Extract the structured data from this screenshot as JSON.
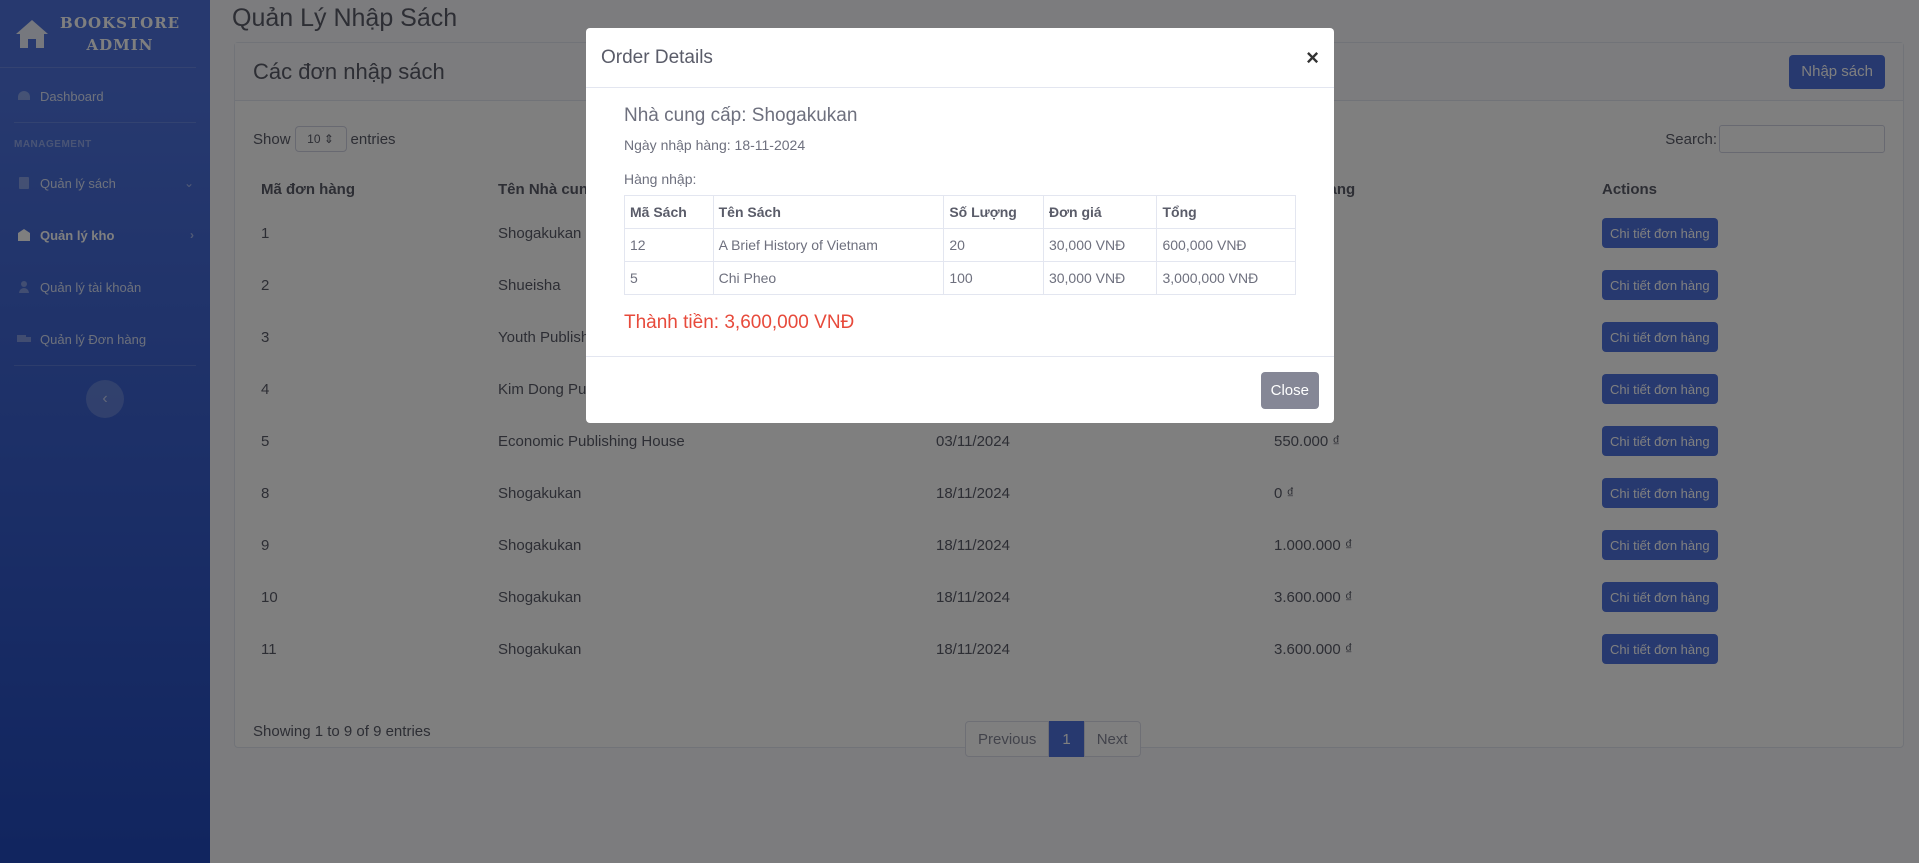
{
  "brand": {
    "line1": "BOOKSTORE",
    "line2": "ADMIN"
  },
  "sidebar": {
    "dashboard": "Dashboard",
    "heading": "MANAGEMENT",
    "items": [
      {
        "label": "Quản lý sách",
        "icon": "book-icon",
        "chevron": "chevron-down-icon"
      },
      {
        "label": "Quản lý kho",
        "icon": "warehouse-icon",
        "chevron": "chevron-right-icon"
      },
      {
        "label": "Quản lý tài khoản",
        "icon": "user-icon"
      },
      {
        "label": "Quản lý Đơn hàng",
        "icon": "truck-icon"
      }
    ]
  },
  "page": {
    "title": "Quản Lý Nhập Sách"
  },
  "card": {
    "title": "Các đơn nhập sách",
    "add_button": "Nhập sách",
    "show_label": "Show",
    "show_value": "10",
    "entries_label": "entries",
    "search_label": "Search:",
    "columns": [
      "Mã đơn hàng",
      "Tên Nhà cung",
      "",
      "n hàng",
      "Actions"
    ],
    "rows": [
      {
        "id": "1",
        "supplier": "Shogakukan",
        "date": "",
        "total": ""
      },
      {
        "id": "2",
        "supplier": "Shueisha",
        "date": "",
        "total": ""
      },
      {
        "id": "3",
        "supplier": "Youth Publish",
        "date": "",
        "total": ""
      },
      {
        "id": "4",
        "supplier": "Kim Dong Pu",
        "date": "",
        "total": ""
      },
      {
        "id": "5",
        "supplier": "Economic Publishing House",
        "date": "03/11/2024",
        "total": "550.000 ₫"
      },
      {
        "id": "8",
        "supplier": "Shogakukan",
        "date": "18/11/2024",
        "total": "0 ₫"
      },
      {
        "id": "9",
        "supplier": "Shogakukan",
        "date": "18/11/2024",
        "total": "1.000.000 ₫"
      },
      {
        "id": "10",
        "supplier": "Shogakukan",
        "date": "18/11/2024",
        "total": "3.600.000 ₫"
      },
      {
        "id": "11",
        "supplier": "Shogakukan",
        "date": "18/11/2024",
        "total": "3.600.000 ₫"
      }
    ],
    "action_label": "Chi tiết đơn hàng",
    "info": "Showing 1 to 9 of 9 entries",
    "pager": {
      "prev": "Previous",
      "current": "1",
      "next": "Next"
    }
  },
  "modal": {
    "title": "Order Details",
    "close_x": "×",
    "supplier": "Nhà cung cấp: Shogakukan",
    "date": "Ngày nhập hàng: 18-11-2024",
    "goods_label": "Hàng nhập:",
    "columns": [
      "Mã Sách",
      "Tên Sách",
      "Số Lượng",
      "Đơn giá",
      "Tổng"
    ],
    "items": [
      [
        "12",
        "A Brief History of Vietnam",
        "20",
        "30,000 VNĐ",
        "600,000 VNĐ"
      ],
      [
        "5",
        "Chi Pheo",
        "100",
        "30,000 VNĐ",
        "3,000,000 VNĐ"
      ]
    ],
    "total": "Thành tiền: 3,600,000 VNĐ",
    "close_button": "Close"
  },
  "colors": {
    "primary": "#4e73df",
    "danger": "#e74a3b",
    "secondary": "#858796"
  }
}
